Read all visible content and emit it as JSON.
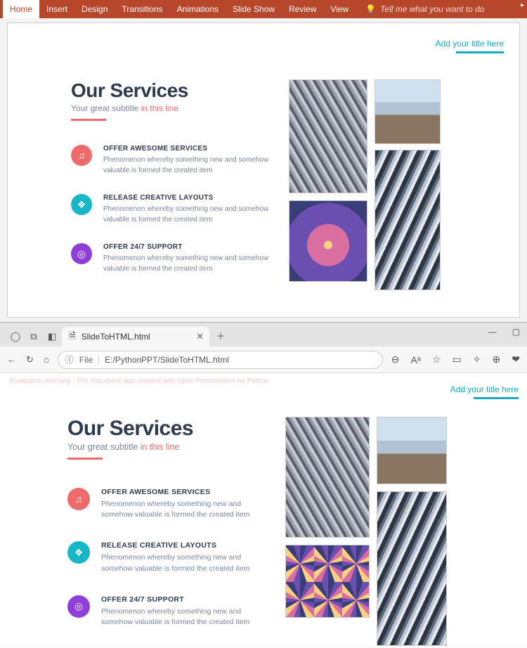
{
  "ribbon": {
    "tabs": [
      "Home",
      "Insert",
      "Design",
      "Transitions",
      "Animations",
      "Slide Show",
      "Review",
      "View"
    ],
    "tell_me": "Tell me what you want to do"
  },
  "slide": {
    "title_placeholder": "Add your title here",
    "heading": "Our Services",
    "subtitle_pre": "Your great subtitle ",
    "subtitle_accent": "in this line",
    "services": [
      {
        "title": "OFFER AWESOME SERVICES",
        "desc": "Phenomenon whereby something new and somehow valuable is formed the created item",
        "icon": "headphones-icon",
        "glyph": "♫"
      },
      {
        "title": "RELEASE CREATIVE LAYOUTS",
        "desc": "Phenomenon whereby something new and somehow valuable is formed the created item",
        "icon": "layers-icon",
        "glyph": "❖"
      },
      {
        "title": "OFFER 24/7 SUPPORT",
        "desc": "Phenomenon whereby something new and somehow valuable is formed the created item",
        "icon": "lifebuoy-icon",
        "glyph": "◎"
      }
    ]
  },
  "browser": {
    "tab_title": "SlideToHTML.html",
    "url_scheme": "File",
    "url_path": "E:/PythonPPT/SlideToHTML.html",
    "warning": "Evaluation Warning : The document was created with Spire.Presentation for Python"
  },
  "colors": {
    "ribbon": "#b7472a",
    "accent_cyan": "#1aa9c4",
    "accent_coral": "#ef6a6a",
    "icon_teal": "#18b7c7",
    "icon_purple": "#8e3fd9",
    "heading_navy": "#2e3b4e"
  }
}
